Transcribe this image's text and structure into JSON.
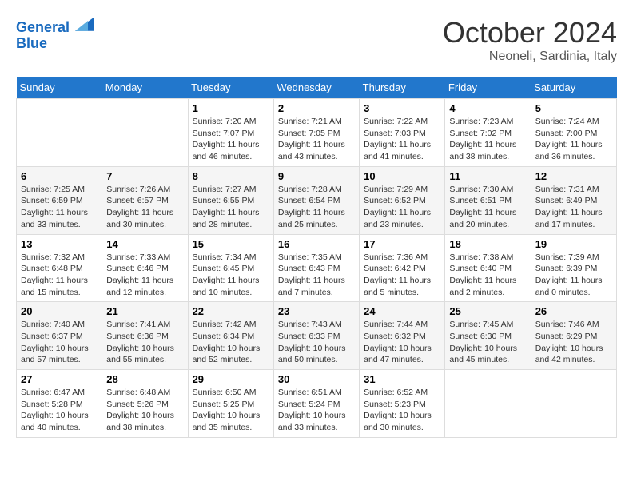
{
  "header": {
    "logo_line1": "General",
    "logo_line2": "Blue",
    "title": "October 2024",
    "subtitle": "Neoneli, Sardinia, Italy"
  },
  "calendar": {
    "days_of_week": [
      "Sunday",
      "Monday",
      "Tuesday",
      "Wednesday",
      "Thursday",
      "Friday",
      "Saturday"
    ],
    "weeks": [
      [
        {
          "day": "",
          "detail": ""
        },
        {
          "day": "",
          "detail": ""
        },
        {
          "day": "1",
          "detail": "Sunrise: 7:20 AM\nSunset: 7:07 PM\nDaylight: 11 hours and 46 minutes."
        },
        {
          "day": "2",
          "detail": "Sunrise: 7:21 AM\nSunset: 7:05 PM\nDaylight: 11 hours and 43 minutes."
        },
        {
          "day": "3",
          "detail": "Sunrise: 7:22 AM\nSunset: 7:03 PM\nDaylight: 11 hours and 41 minutes."
        },
        {
          "day": "4",
          "detail": "Sunrise: 7:23 AM\nSunset: 7:02 PM\nDaylight: 11 hours and 38 minutes."
        },
        {
          "day": "5",
          "detail": "Sunrise: 7:24 AM\nSunset: 7:00 PM\nDaylight: 11 hours and 36 minutes."
        }
      ],
      [
        {
          "day": "6",
          "detail": "Sunrise: 7:25 AM\nSunset: 6:59 PM\nDaylight: 11 hours and 33 minutes."
        },
        {
          "day": "7",
          "detail": "Sunrise: 7:26 AM\nSunset: 6:57 PM\nDaylight: 11 hours and 30 minutes."
        },
        {
          "day": "8",
          "detail": "Sunrise: 7:27 AM\nSunset: 6:55 PM\nDaylight: 11 hours and 28 minutes."
        },
        {
          "day": "9",
          "detail": "Sunrise: 7:28 AM\nSunset: 6:54 PM\nDaylight: 11 hours and 25 minutes."
        },
        {
          "day": "10",
          "detail": "Sunrise: 7:29 AM\nSunset: 6:52 PM\nDaylight: 11 hours and 23 minutes."
        },
        {
          "day": "11",
          "detail": "Sunrise: 7:30 AM\nSunset: 6:51 PM\nDaylight: 11 hours and 20 minutes."
        },
        {
          "day": "12",
          "detail": "Sunrise: 7:31 AM\nSunset: 6:49 PM\nDaylight: 11 hours and 17 minutes."
        }
      ],
      [
        {
          "day": "13",
          "detail": "Sunrise: 7:32 AM\nSunset: 6:48 PM\nDaylight: 11 hours and 15 minutes."
        },
        {
          "day": "14",
          "detail": "Sunrise: 7:33 AM\nSunset: 6:46 PM\nDaylight: 11 hours and 12 minutes."
        },
        {
          "day": "15",
          "detail": "Sunrise: 7:34 AM\nSunset: 6:45 PM\nDaylight: 11 hours and 10 minutes."
        },
        {
          "day": "16",
          "detail": "Sunrise: 7:35 AM\nSunset: 6:43 PM\nDaylight: 11 hours and 7 minutes."
        },
        {
          "day": "17",
          "detail": "Sunrise: 7:36 AM\nSunset: 6:42 PM\nDaylight: 11 hours and 5 minutes."
        },
        {
          "day": "18",
          "detail": "Sunrise: 7:38 AM\nSunset: 6:40 PM\nDaylight: 11 hours and 2 minutes."
        },
        {
          "day": "19",
          "detail": "Sunrise: 7:39 AM\nSunset: 6:39 PM\nDaylight: 11 hours and 0 minutes."
        }
      ],
      [
        {
          "day": "20",
          "detail": "Sunrise: 7:40 AM\nSunset: 6:37 PM\nDaylight: 10 hours and 57 minutes."
        },
        {
          "day": "21",
          "detail": "Sunrise: 7:41 AM\nSunset: 6:36 PM\nDaylight: 10 hours and 55 minutes."
        },
        {
          "day": "22",
          "detail": "Sunrise: 7:42 AM\nSunset: 6:34 PM\nDaylight: 10 hours and 52 minutes."
        },
        {
          "day": "23",
          "detail": "Sunrise: 7:43 AM\nSunset: 6:33 PM\nDaylight: 10 hours and 50 minutes."
        },
        {
          "day": "24",
          "detail": "Sunrise: 7:44 AM\nSunset: 6:32 PM\nDaylight: 10 hours and 47 minutes."
        },
        {
          "day": "25",
          "detail": "Sunrise: 7:45 AM\nSunset: 6:30 PM\nDaylight: 10 hours and 45 minutes."
        },
        {
          "day": "26",
          "detail": "Sunrise: 7:46 AM\nSunset: 6:29 PM\nDaylight: 10 hours and 42 minutes."
        }
      ],
      [
        {
          "day": "27",
          "detail": "Sunrise: 6:47 AM\nSunset: 5:28 PM\nDaylight: 10 hours and 40 minutes."
        },
        {
          "day": "28",
          "detail": "Sunrise: 6:48 AM\nSunset: 5:26 PM\nDaylight: 10 hours and 38 minutes."
        },
        {
          "day": "29",
          "detail": "Sunrise: 6:50 AM\nSunset: 5:25 PM\nDaylight: 10 hours and 35 minutes."
        },
        {
          "day": "30",
          "detail": "Sunrise: 6:51 AM\nSunset: 5:24 PM\nDaylight: 10 hours and 33 minutes."
        },
        {
          "day": "31",
          "detail": "Sunrise: 6:52 AM\nSunset: 5:23 PM\nDaylight: 10 hours and 30 minutes."
        },
        {
          "day": "",
          "detail": ""
        },
        {
          "day": "",
          "detail": ""
        }
      ]
    ]
  }
}
